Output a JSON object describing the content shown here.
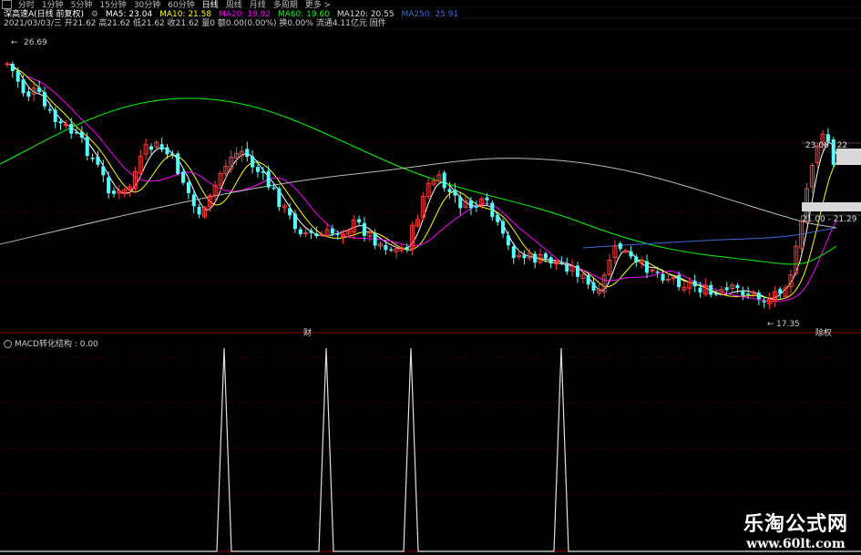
{
  "toolbar": {
    "tabs": [
      "分时",
      "1分钟",
      "5分钟",
      "15分钟",
      "30分钟",
      "60分钟",
      "日线",
      "周线",
      "月线",
      "多周期",
      "更多 >"
    ],
    "active_tab": "日线"
  },
  "ma_bar": {
    "stock": "深高速A(日线 前复权)",
    "ma5": "MA5: 23.04",
    "ma10": "MA10: 21.58",
    "ma20": "MA20: 19.92",
    "ma60": "MA60: 19.60",
    "ma120": "MA120: 20.55",
    "ma250": "MA250: 25.91"
  },
  "info_bar": {
    "text": "2021/03/03/三 开21.62 高21.62 低21.62 收21.62 量0 额0.00(0.00%) 换0.00% 流通4.11亿元 固件"
  },
  "price_labels": {
    "high": "26.69",
    "low": "17.35",
    "right_top": "23.06 - 22",
    "right_mid": "21.00 - 21.29"
  },
  "markers": {
    "financial": "财",
    "rights": "除权"
  },
  "indicator": {
    "label": "MACD转化结构 : 0.00",
    "spike_count": 4
  },
  "watermark": {
    "line1": "乐淘公式网",
    "line2": "www.60lt.com"
  },
  "colors": {
    "up": "#ff3b3b",
    "down": "#54ffff",
    "ma5": "#ffffff",
    "ma10": "#ffff00",
    "ma20": "#ff00ff",
    "ma60": "#00ff00",
    "ma120": "#3a6bd6",
    "ma250": "#bbbbbb"
  }
}
